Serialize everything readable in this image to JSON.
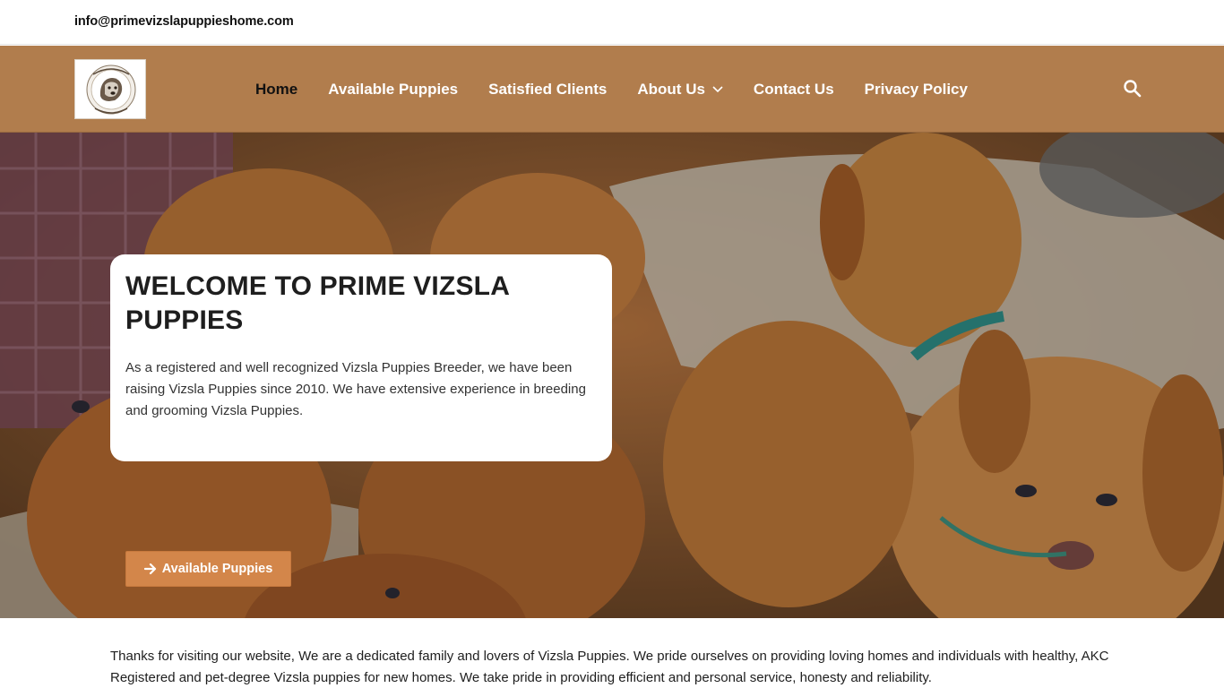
{
  "topbar": {
    "email": "info@primevizslapuppieshome.com"
  },
  "logo": {
    "alt": "My Vizsla is my best friend logo"
  },
  "nav": {
    "items": [
      {
        "label": "Home",
        "active": true
      },
      {
        "label": "Available Puppies"
      },
      {
        "label": "Satisfied Clients"
      },
      {
        "label": "About Us",
        "has_dropdown": true
      },
      {
        "label": "Contact Us"
      },
      {
        "label": "Privacy Policy"
      }
    ],
    "search_icon": "search-icon"
  },
  "hero": {
    "title": "WELCOME TO PRIME VIZSLA PUPPIES",
    "text": "As a registered and well recognized Vizsla Puppies Breeder, we have been raising  Vizsla Puppies since 2010. We have extensive experience in breeding and grooming Vizsla Puppies.",
    "cta_label": "Available Puppies",
    "cta_icon": "arrow-right-icon"
  },
  "intro": {
    "text": "Thanks for visiting our website, We are a dedicated family and lovers of Vizsla Puppies. We pride ourselves on providing loving homes and individuals with healthy, AKC Registered and pet-degree Vizsla puppies for new homes. We take pride in providing efficient and personal service, honesty and reliability."
  },
  "colors": {
    "nav_bg": "#b17d4d",
    "cta_bg": "#d3864a",
    "active_nav": "#111111",
    "nav_text": "#ffffff"
  }
}
